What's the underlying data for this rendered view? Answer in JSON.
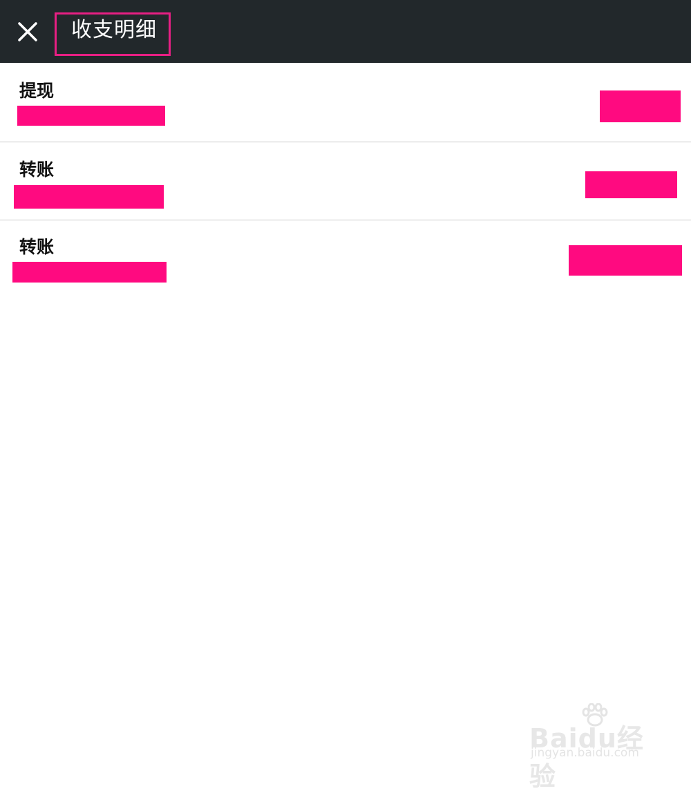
{
  "header": {
    "title": "收支明细",
    "close_icon": "close-icon",
    "background": "#22282b",
    "highlight_color": "#e81f84"
  },
  "transactions": [
    {
      "label": "提现"
    },
    {
      "label": "转账"
    },
    {
      "label": "转账"
    }
  ],
  "redaction_color": "#ff0a80",
  "watermark": {
    "brand": "Baidu经验",
    "url": "jingyan.baidu.com"
  }
}
